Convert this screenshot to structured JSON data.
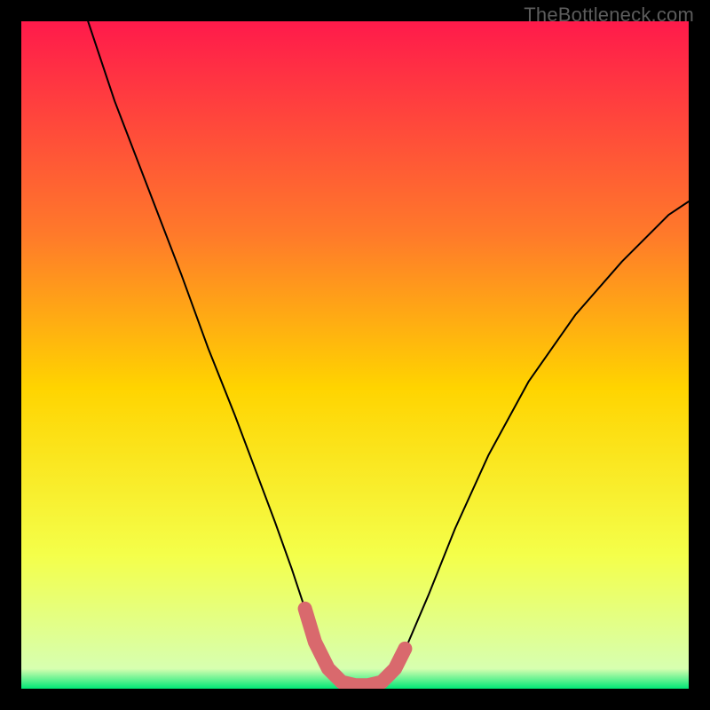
{
  "watermark": "TheBottleneck.com",
  "colors": {
    "gradient_top": "#ff1a4b",
    "gradient_mid1": "#ff7a2a",
    "gradient_mid2": "#ffd400",
    "gradient_mid3": "#f4ff4a",
    "gradient_bottom": "#00e676",
    "frame": "#000000",
    "curve": "#000000",
    "highlight": "#d9696d"
  },
  "chart_data": {
    "type": "line",
    "title": "",
    "xlabel": "",
    "ylabel": "",
    "xlim": [
      0,
      100
    ],
    "ylim": [
      0,
      100
    ],
    "series": [
      {
        "name": "curve",
        "x": [
          10,
          14,
          19,
          24,
          28,
          32,
          35,
          38,
          40.5,
          42.5,
          44,
          46,
          48,
          50,
          52,
          54,
          56,
          58,
          61,
          65,
          70,
          76,
          83,
          90,
          97,
          100
        ],
        "y": [
          100,
          88,
          75,
          62,
          51,
          41,
          33,
          25,
          18,
          12,
          7,
          3,
          1,
          0.5,
          0.5,
          1,
          3,
          7,
          14,
          24,
          35,
          46,
          56,
          64,
          71,
          73
        ]
      },
      {
        "name": "highlight",
        "x": [
          42.5,
          44,
          46,
          48,
          50,
          52,
          54,
          56,
          57.5
        ],
        "y": [
          12,
          7,
          3,
          1,
          0.5,
          0.5,
          1,
          3,
          6
        ]
      }
    ]
  }
}
